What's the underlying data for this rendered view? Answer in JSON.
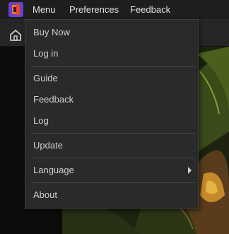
{
  "menubar": {
    "items": [
      {
        "label": "Menu"
      },
      {
        "label": "Preferences"
      },
      {
        "label": "Feedback"
      }
    ]
  },
  "toolbar": {
    "home_icon": "home-icon"
  },
  "dropdown": {
    "groups": [
      [
        {
          "label": "Buy Now"
        },
        {
          "label": "Log in"
        }
      ],
      [
        {
          "label": "Guide"
        },
        {
          "label": "Feedback"
        },
        {
          "label": "Log"
        }
      ],
      [
        {
          "label": "Update"
        }
      ],
      [
        {
          "label": "Language",
          "has_submenu": true
        }
      ],
      [
        {
          "label": "About"
        }
      ]
    ]
  },
  "colors": {
    "menubar_bg": "#1e1e1e",
    "menu_bg": "#2a2a2a",
    "logo_purple": "#6a3fd0",
    "logo_orange": "#f07a1a"
  }
}
